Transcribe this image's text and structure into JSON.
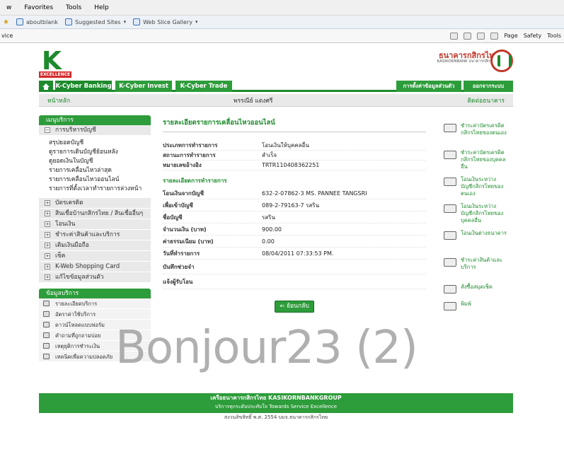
{
  "browser": {
    "menu": [
      "w",
      "Favorites",
      "Tools",
      "Help"
    ],
    "favorites": [
      {
        "label": "aboutblank"
      },
      {
        "label": "Suggested Sites"
      },
      {
        "label": "Web Slice Gallery"
      }
    ],
    "tab_title": "vice",
    "tools": [
      "Page",
      "Safety",
      "Tools"
    ]
  },
  "header": {
    "logo_excellence": "EXCELLENCE",
    "bank_name": "ธนาคารกสิกรไทย",
    "bank_sub": "KASIKORNBANK ธนาคารกสิกรไทย"
  },
  "tabs": {
    "banking": "K-Cyber Banking",
    "invest": "K-Cyber Invest",
    "trade": "K-Cyber Trade",
    "personal": "การตั้งค่าข้อมูลส่วนตัว",
    "logout": "ออกจากระบบ"
  },
  "subbar": {
    "home": "หน้าหลัก",
    "user": "พรรณีย์ แตงศรี",
    "contact": "ติดต่อธนาคาร"
  },
  "sidebar": {
    "menu_title": "เมนูบริการ",
    "account_section": "การบริหารบัญชี",
    "account_items": [
      "สรุปยอดบัญชี",
      "ดูรายการเดินบัญชีย้อนหลัง",
      "ดูยอดเงินในบัญชี",
      "รายการเคลื่อนไหวล่าสุด",
      "รายการเคลื่อนไหวออนไลน์",
      "รายการที่ตั้งเวลาทำรายการล่วงหน้า"
    ],
    "sections": [
      "บัตรเครดิต",
      "สินเชื่อบ้านกสิกรไทย / สินเชื่ออื่นๆ",
      "โอนเงิน",
      "ชำระค่าสินค้าและบริการ",
      "เติมเงินมือถือ",
      "เช็ค",
      "K-Web Shopping Card",
      "แก้ไขข้อมูลส่วนตัว"
    ],
    "help_title": "ข้อมูลบริการ",
    "help_items": [
      "รายละเอียดบริการ",
      "อัตราค่าใช้บริการ",
      "ดาวน์โหลดแบบฟอร์ม",
      "คำถามที่ถูกถามบ่อย",
      "เหตุยุติการชำระเงิน",
      "เทคนิคเพื่อความปลอดภัย"
    ]
  },
  "main": {
    "title": "รายละเอียดรายการเคลื่อนไหวออนไลน์",
    "info_rows": [
      {
        "label": "ประเภทการทำรายการ",
        "value": "โอนเงินให้บุคคลอื่น"
      },
      {
        "label": "สถานะการทำรายการ",
        "value": "สำเร็จ"
      },
      {
        "label": "หมายเลขอ้างอิง",
        "value": "TRTR110408362251"
      }
    ],
    "detail_title": "รายละเอียดการทำรายการ",
    "detail_rows": [
      {
        "label": "โอนเงินจากบัญชี",
        "value": "632-2-07862-3 MS. PANNEE TANGSRI"
      },
      {
        "label": "เพื่อเข้าบัญชี",
        "value": "089-2-79163-7 รสริน"
      },
      {
        "label": "ชื่อบัญชี",
        "value": "รสริน"
      },
      {
        "label": "จำนวนเงิน (บาท)",
        "value": "900.00"
      },
      {
        "label": "ค่าธรรมเนียม (บาท)",
        "value": "0.00"
      },
      {
        "label": "วันที่ทำรายการ",
        "value": "08/04/2011 07:33:53 PM."
      },
      {
        "label": "บันทึกช่วยจำ",
        "value": ""
      },
      {
        "label": "แจ้งผู้รับโอน",
        "value": ""
      }
    ],
    "back_button": "ย้อนกลับ"
  },
  "right_menu": [
    "ชำระค่าบัตรเครดิตกสิกรไทยของตนเอง",
    "ชำระค่าบัตรเครดิตกสิกรไทยของบุคคลอื่น",
    "โอนเงินระหว่างบัญชีกสิกรไทยของตนเอง",
    "โอนเงินระหว่างบัญชีกสิกรไทยของบุคคลอื่น",
    "โอนเงินต่างธนาคาร",
    "ชำระค่าสินค้าและบริการ",
    "สั่งซื้อสมุดเช็ค",
    "พิมพ์"
  ],
  "watermark": "Bonjour23 (2)",
  "footer": {
    "line1": "เครือธนาคารกสิกรไทย KASIKORNBANKGROUP",
    "line2": "บริการทุกระดับประทับใจ Towards Service Excellence",
    "copyright": "สงวนลิขสิทธิ์ พ.ศ. 2554 บมจ.ธนาคารกสิกรไทย"
  }
}
